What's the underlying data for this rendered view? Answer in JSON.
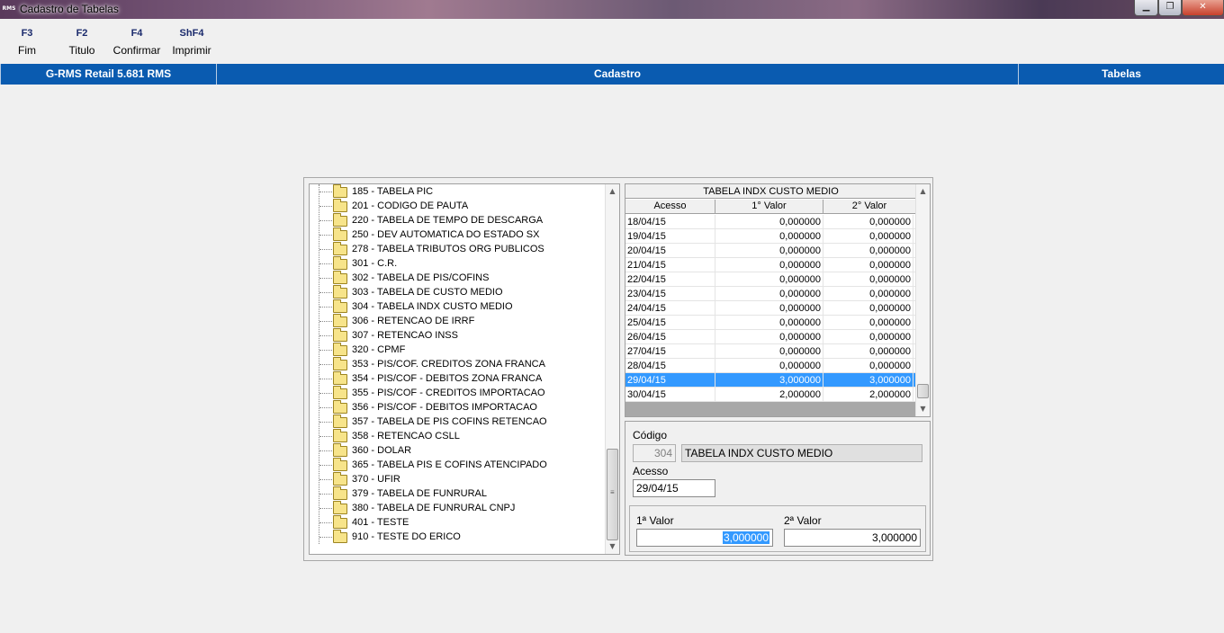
{
  "window": {
    "title": "Cadastro de Tabelas",
    "app_icon_text": "RMS",
    "minimize": "▁",
    "maximize": "❐",
    "close": "✕"
  },
  "toolbar": [
    {
      "key": "F3",
      "label": "Fim"
    },
    {
      "key": "F2",
      "label": "Titulo"
    },
    {
      "key": "F4",
      "label": "Confirmar"
    },
    {
      "key": "ShF4",
      "label": "Imprimir"
    }
  ],
  "header": {
    "app": "G-RMS Retail 5.681 RMS",
    "module": "Cadastro",
    "section": "Tabelas"
  },
  "tree_items": [
    "185 - TABELA PIC",
    "201 - CODIGO DE PAUTA",
    "220 - TABELA DE TEMPO DE DESCARGA",
    "250 - DEV AUTOMATICA DO ESTADO SX",
    "278 - TABELA TRIBUTOS ORG PUBLICOS",
    "301 - C.R.",
    "302 - TABELA DE PIS/COFINS",
    "303 - TABELA DE CUSTO MEDIO",
    "304 - TABELA INDX CUSTO MEDIO",
    "306 - RETENCAO DE IRRF",
    "307 - RETENCAO INSS",
    "320 - CPMF",
    "353 - PIS/COF. CREDITOS ZONA FRANCA",
    "354 - PIS/COF - DEBITOS ZONA FRANCA",
    "355 - PIS/COF - CREDITOS IMPORTACAO",
    "356 - PIS/COF - DEBITOS IMPORTACAO",
    "357 - TABELA DE PIS COFINS RETENCAO",
    "358 - RETENCAO CSLL",
    "360 - DOLAR",
    "365 - TABELA PIS E COFINS ATENCIPADO",
    "370 - UFIR",
    "379 - TABELA DE FUNRURAL",
    "380 - TABELA DE FUNRURAL CNPJ",
    "401 - TESTE",
    "910 - TESTE DO ERICO"
  ],
  "grid": {
    "title": "TABELA INDX CUSTO MEDIO",
    "columns": [
      "Acesso",
      "1° Valor",
      "2° Valor"
    ],
    "rows": [
      [
        "18/04/15",
        "0,000000",
        "0,000000"
      ],
      [
        "19/04/15",
        "0,000000",
        "0,000000"
      ],
      [
        "20/04/15",
        "0,000000",
        "0,000000"
      ],
      [
        "21/04/15",
        "0,000000",
        "0,000000"
      ],
      [
        "22/04/15",
        "0,000000",
        "0,000000"
      ],
      [
        "23/04/15",
        "0,000000",
        "0,000000"
      ],
      [
        "24/04/15",
        "0,000000",
        "0,000000"
      ],
      [
        "25/04/15",
        "0,000000",
        "0,000000"
      ],
      [
        "26/04/15",
        "0,000000",
        "0,000000"
      ],
      [
        "27/04/15",
        "0,000000",
        "0,000000"
      ],
      [
        "28/04/15",
        "0,000000",
        "0,000000"
      ],
      [
        "29/04/15",
        "3,000000",
        "3,000000"
      ],
      [
        "30/04/15",
        "2,000000",
        "2,000000"
      ]
    ],
    "selected_row": 11
  },
  "form": {
    "codigo_label": "Código",
    "codigo_value": "304",
    "descricao_value": "TABELA INDX CUSTO MEDIO",
    "acesso_label": "Acesso",
    "acesso_value": "29/04/15",
    "valor1_label": "1ª Valor",
    "valor1_value": "3,000000",
    "valor2_label": "2ª Valor",
    "valor2_value": "3,000000"
  },
  "scroll": {
    "up": "▲",
    "down": "▼",
    "grip": "≡"
  },
  "colors": {
    "header_blue": "#0a5bb0",
    "selection": "#3399ff"
  }
}
